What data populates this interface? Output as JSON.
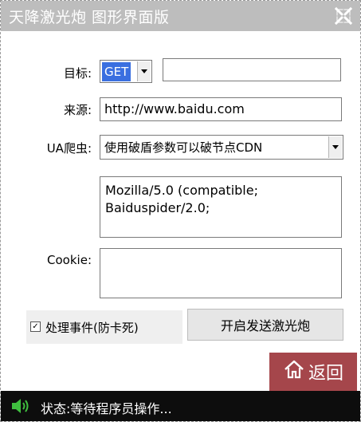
{
  "window": {
    "title": "天降激光炮 图形界面版",
    "title_color": "#ffffff",
    "titlebar_bg": "#bdbdbd"
  },
  "form": {
    "target_label": "目标:",
    "method_value": "GET",
    "target_url_value": "",
    "source_label": "来源:",
    "source_value": "http://www.baidu.com",
    "ua_label": "UA爬虫:",
    "ua_select_value": "使用破盾参数可以破节点CDN",
    "ua_text_value": "Mozilla/5.0 (compatible;\nBaiduspider/2.0;",
    "cookie_label": "Cookie:",
    "cookie_value": ""
  },
  "options": {
    "handle_events_label": "处理事件(防卡死)",
    "handle_events_checked": "✓"
  },
  "actions": {
    "fire_label": "开启发送激光炮",
    "back_label": "返回",
    "back_bg": "#a5464b"
  },
  "status": {
    "text": "状态:等待程序员操作..."
  },
  "icons": [
    "close-icon",
    "dropdown-arrow-icon",
    "home-icon",
    "speaker-icon"
  ]
}
